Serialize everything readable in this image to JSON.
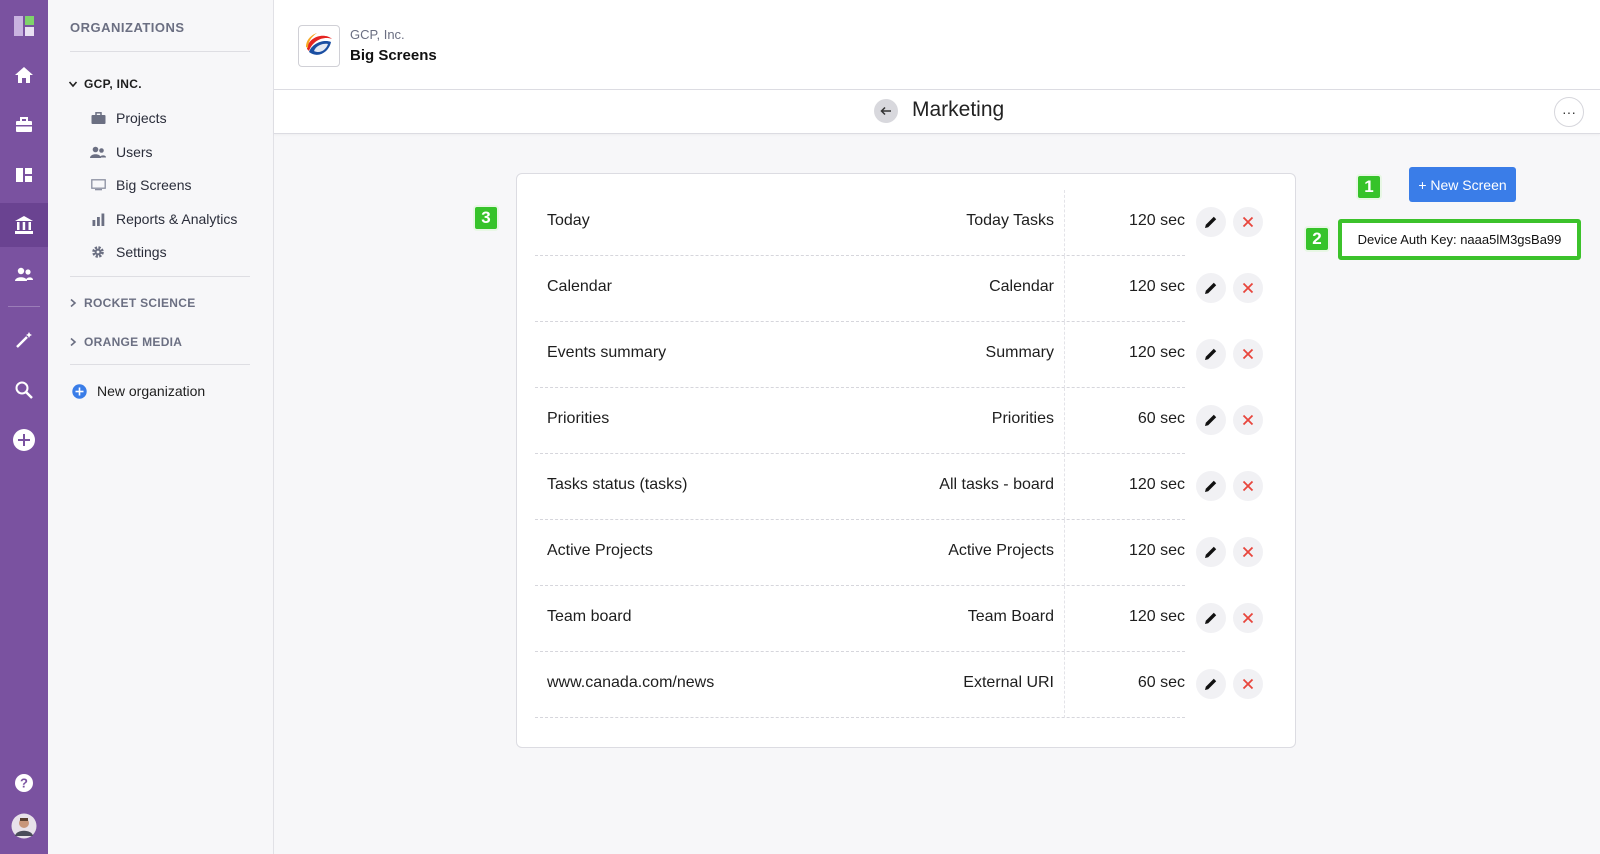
{
  "sidebar": {
    "heading": "ORGANIZATIONS",
    "orgs": [
      {
        "label": "GCP, INC."
      },
      {
        "label": "ROCKET SCIENCE"
      },
      {
        "label": "ORANGE MEDIA"
      }
    ],
    "items": [
      {
        "label": "Projects",
        "icon": "briefcase-icon"
      },
      {
        "label": "Users",
        "icon": "users-icon"
      },
      {
        "label": "Big Screens",
        "icon": "monitor-icon"
      },
      {
        "label": "Reports & Analytics",
        "icon": "bar-chart-icon"
      },
      {
        "label": "Settings",
        "icon": "gear-icon"
      }
    ],
    "new_org_label": "New organization"
  },
  "header": {
    "org_name": "GCP, Inc.",
    "page_name": "Big Screens"
  },
  "subheader": {
    "title": "Marketing",
    "more_label": "···"
  },
  "screens": [
    {
      "name": "Today",
      "type": "Today Tasks",
      "duration": "120 sec"
    },
    {
      "name": "Calendar",
      "type": "Calendar",
      "duration": "120 sec"
    },
    {
      "name": "Events summary",
      "type": "Summary",
      "duration": "120 sec"
    },
    {
      "name": "Priorities",
      "type": "Priorities",
      "duration": "60 sec"
    },
    {
      "name": "Tasks status (tasks)",
      "type": "All tasks - board",
      "duration": "120 sec"
    },
    {
      "name": "Active Projects",
      "type": "Active Projects",
      "duration": "120 sec"
    },
    {
      "name": "Team board",
      "type": "Team Board",
      "duration": "120 sec"
    },
    {
      "name": "www.canada.com/news",
      "type": "External URI",
      "duration": "60 sec"
    }
  ],
  "actions": {
    "new_screen_label": "+ New Screen",
    "auth_key_label": "Device Auth Key: naaa5lM3gsBa99"
  },
  "badges": [
    "1",
    "2",
    "3"
  ],
  "colors": {
    "rail": "#7a52a0",
    "primary": "#3a7de8",
    "highlight": "#3cc22b",
    "delete": "#e8453c"
  }
}
